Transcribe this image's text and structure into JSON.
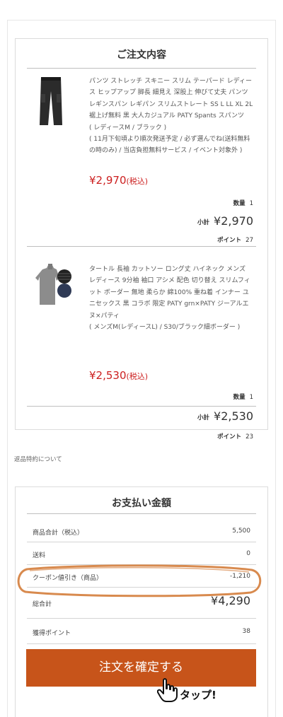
{
  "order": {
    "title": "ご注文内容",
    "items": [
      {
        "thumb_icon": "black-pants-icon",
        "name": "パンツ ストレッチ スキニー スリム テーパード レディース ヒップアップ 脚長 細見え 深股上 伸びて丈夫 パンツ レギンスパン レギパン スリムストレート SS L LL XL 2L 裾上げ無料 黒 大人カジュアル PATY Spants スパンツ",
        "variant": "( レディースM / ブラック )",
        "note": "( 11月下旬頃より順次発送予定 / 必ず選んでね(送料無料の時のみ) / 当店負担無料サービス / イベント対象外 )",
        "price": "¥2,970",
        "price_tax": "(税込)",
        "qty_label": "数量",
        "qty": "1",
        "subtotal_label": "小計",
        "subtotal": "¥2,970",
        "points_label": "ポイント",
        "points": "27"
      },
      {
        "thumb_icon": "turtleneck-shirt-icon",
        "name": "タートル 長袖 カットソー ロング丈 ハイネック メンズ レディース 9分袖 袖口 アシメ 配色 切り替え スリムフィット ボーダー 無地 柔らか 綿100% 重ね着 インナー ユニセックス 黒 コラボ 限定 PATY grn×PATY ジーアルエヌ×パティ",
        "variant": "( メンズM(レディースL) / S30/ブラック細ボーダー )",
        "note": "",
        "price": "¥2,530",
        "price_tax": "(税込)",
        "qty_label": "数量",
        "qty": "1",
        "subtotal_label": "小計",
        "subtotal": "¥2,530",
        "points_label": "ポイント",
        "points": "23"
      }
    ]
  },
  "returns_link": "返品特約について",
  "payment": {
    "title": "お支払い金額",
    "rows": {
      "subtotal": {
        "label": "商品合計（税込）",
        "value": "5,500"
      },
      "shipping": {
        "label": "送料",
        "value": "0"
      },
      "coupon": {
        "label": "クーポン値引き（商品）",
        "value": "-1,210"
      },
      "total": {
        "label": "総合計",
        "value": "¥4,290"
      },
      "points": {
        "label": "獲得ポイント",
        "value": "38"
      }
    }
  },
  "confirm_button": "注文を確定する",
  "tap_annotation": "タップ!",
  "colors": {
    "accent_button": "#c7541a",
    "price_red": "#cc1f1f",
    "highlight_orange": "#d88a4e"
  }
}
